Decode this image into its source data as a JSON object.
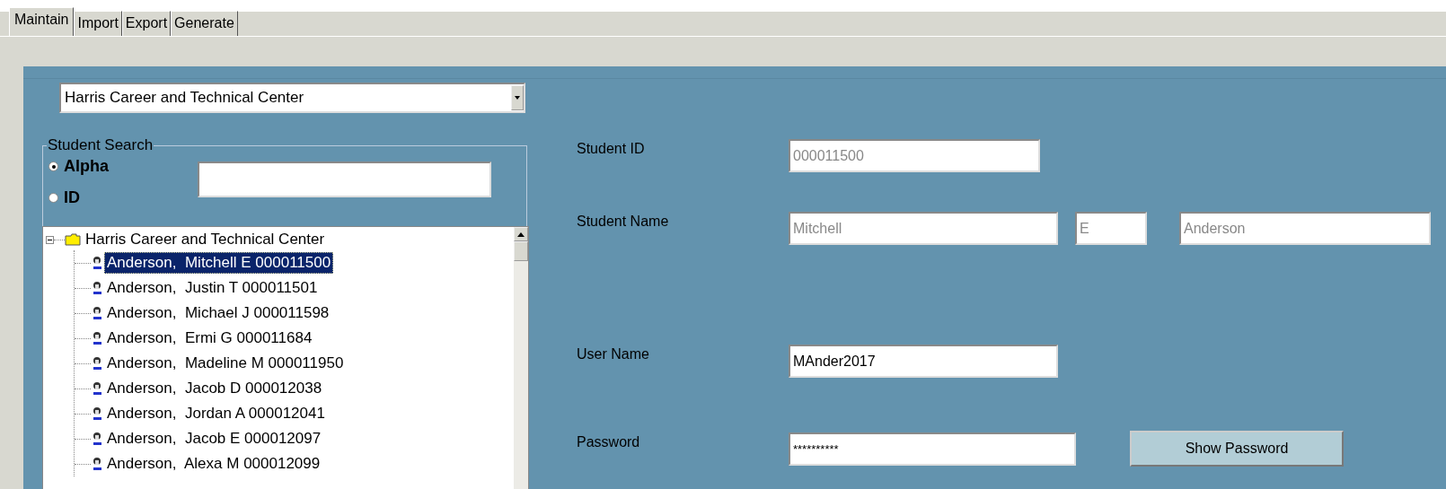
{
  "tabs": [
    {
      "label": "Maintain",
      "selected": true
    },
    {
      "label": "Import",
      "selected": false
    },
    {
      "label": "Export",
      "selected": false
    },
    {
      "label": "Generate",
      "selected": false
    }
  ],
  "school_dropdown": {
    "value": "Harris Career and Technical Center"
  },
  "student_search": {
    "title": "Student Search",
    "options": [
      {
        "label": "Alpha",
        "selected": true
      },
      {
        "label": "ID",
        "selected": false
      }
    ]
  },
  "tree": {
    "root": {
      "label": "Harris Career and Technical Center",
      "expanded": true,
      "children": [
        {
          "label": "Anderson,  Mitchell E 000011500",
          "selected": true
        },
        {
          "label": "Anderson,  Justin T 000011501",
          "selected": false
        },
        {
          "label": "Anderson,  Michael J 000011598",
          "selected": false
        },
        {
          "label": "Anderson,  Ermi G 000011684",
          "selected": false
        },
        {
          "label": "Anderson,  Madeline M 000011950",
          "selected": false
        },
        {
          "label": "Anderson,  Jacob D 000012038",
          "selected": false
        },
        {
          "label": "Anderson,  Jordan A 000012041",
          "selected": false
        },
        {
          "label": "Anderson,  Jacob E 000012097",
          "selected": false
        },
        {
          "label": "Anderson,  Alexa M 000012099",
          "selected": false
        }
      ]
    }
  },
  "details": {
    "student_id": {
      "label": "Student ID",
      "value": "000011500",
      "disabled": true
    },
    "student_name": {
      "label": "Student Name",
      "first": {
        "value": "Mitchell",
        "disabled": true
      },
      "middle": {
        "value": "E",
        "disabled": true
      },
      "last": {
        "value": "Anderson",
        "disabled": true
      }
    },
    "user_name": {
      "label": "User Name",
      "value": "MAnder2017",
      "disabled": false
    },
    "password": {
      "label": "Password",
      "value": "**********",
      "disabled": false
    },
    "show_password_button": "Show Password"
  }
}
